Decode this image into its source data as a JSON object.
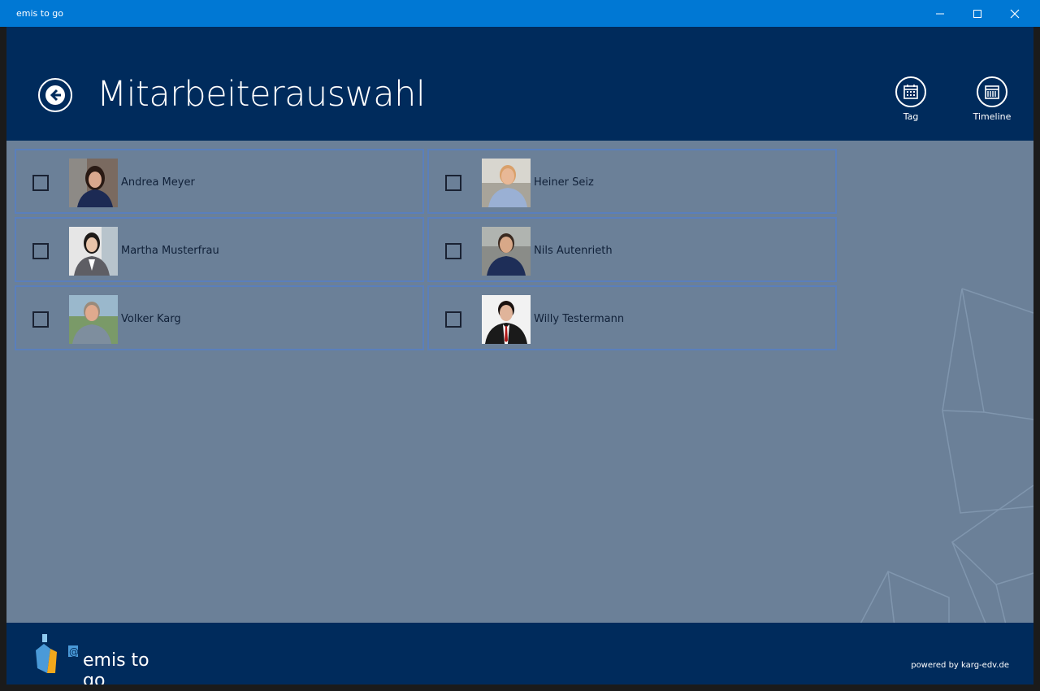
{
  "window": {
    "title": "emis to go"
  },
  "header": {
    "title": "Mitarbeiterauswahl",
    "buttons": [
      {
        "label": "Tag",
        "icon": "calendar-day-icon"
      },
      {
        "label": "Timeline",
        "icon": "calendar-timeline-icon"
      }
    ]
  },
  "employees": [
    {
      "name": "Andrea Meyer",
      "checked": false
    },
    {
      "name": "Heiner Seiz",
      "checked": false
    },
    {
      "name": "Martha Musterfrau",
      "checked": false
    },
    {
      "name": "Nils Autenrieth",
      "checked": false
    },
    {
      "name": "Volker Karg",
      "checked": false
    },
    {
      "name": "Willy Testermann",
      "checked": false
    }
  ],
  "footer": {
    "logo_text": "emis to go",
    "powered_by": "powered by karg-edv.de"
  },
  "colors": {
    "titlebar": "#0078d4",
    "header": "#002b5c",
    "content": "#6b8098",
    "card_border": "#5a7fbc"
  }
}
